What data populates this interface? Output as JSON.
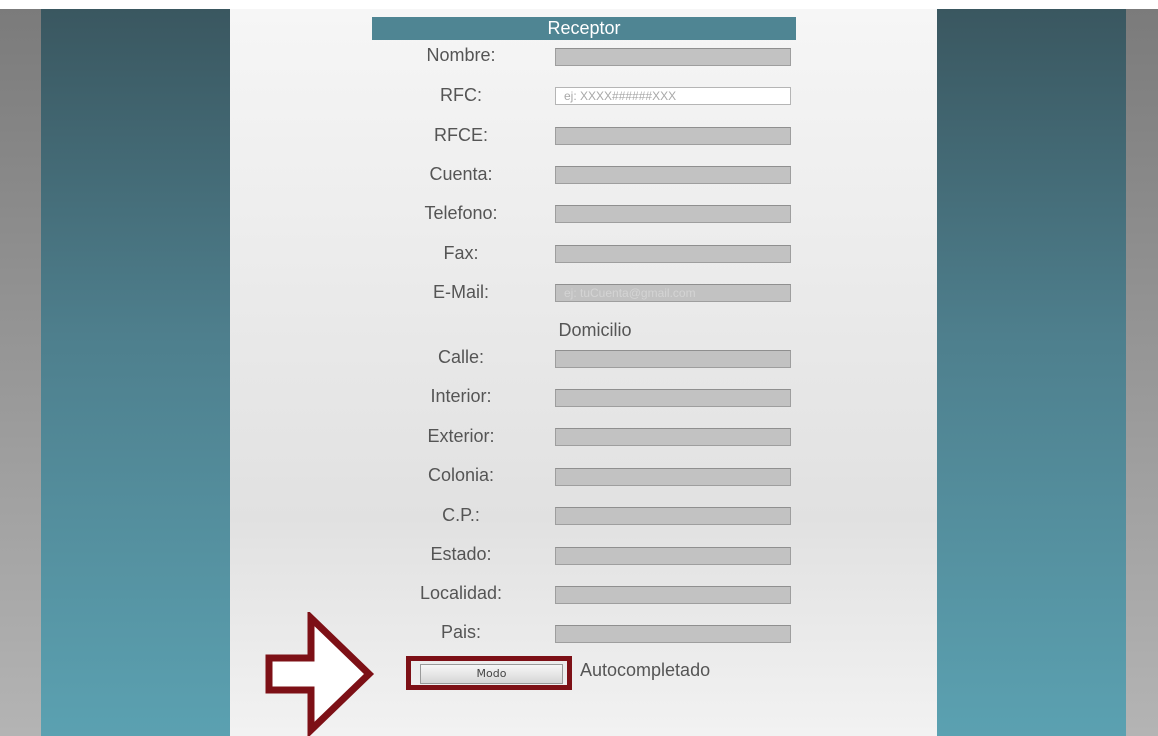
{
  "receptor": {
    "title": "Receptor",
    "fields": [
      {
        "label": "Nombre:",
        "value": "",
        "placeholder": ""
      },
      {
        "label": "RFC:",
        "value": "",
        "placeholder": "ej: XXXX######XXX"
      },
      {
        "label": "RFCE:",
        "value": "",
        "placeholder": ""
      },
      {
        "label": "Cuenta:",
        "value": "",
        "placeholder": ""
      },
      {
        "label": "Telefono:",
        "value": "",
        "placeholder": ""
      },
      {
        "label": "Fax:",
        "value": "",
        "placeholder": ""
      },
      {
        "label": "E-Mail:",
        "value": "",
        "placeholder": "ej: tuCuenta@gmail.com"
      }
    ]
  },
  "domicilio": {
    "title": "Domicilio",
    "fields": [
      {
        "label": "Calle:"
      },
      {
        "label": "Interior:"
      },
      {
        "label": "Exterior:"
      },
      {
        "label": "Colonia:"
      },
      {
        "label": "C.P.:"
      },
      {
        "label": "Estado:"
      },
      {
        "label": "Localidad:"
      },
      {
        "label": "Pais:"
      }
    ]
  },
  "mode": {
    "button_label": "Modo",
    "status_text": "Autocompletado"
  },
  "colors": {
    "header": "#4f8593",
    "highlight": "#7d1016",
    "disabled_input": "#c2c2c2"
  }
}
